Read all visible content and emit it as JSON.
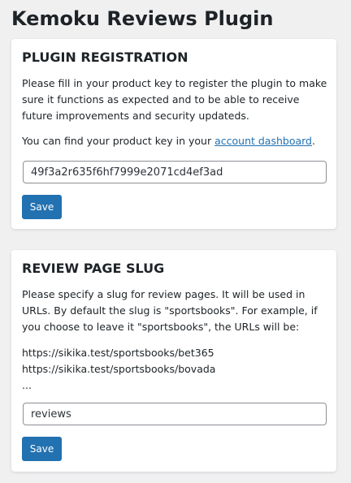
{
  "page": {
    "title": "Kemoku Reviews Plugin"
  },
  "registration": {
    "heading": "PLUGIN REGISTRATION",
    "description": "Please fill in your product key to register the plugin to make sure it functions as expected and to be able to receive future improvements and security updateds.",
    "key_hint_prefix": "You can find your product key in your ",
    "key_hint_link": "account dashboard",
    "key_hint_suffix": ".",
    "product_key_value": "49f3a2r635f6hf7999e2071cd4ef3ad",
    "save_label": "Save"
  },
  "slug": {
    "heading": "REVIEW PAGE SLUG",
    "description": "Please specify a slug for review pages. It will be used in URLs. By default the slug is \"sportsbooks\". For example, if you choose to leave it \"sportsbooks\", the URLs will be:",
    "example_urls": [
      "https://sikika.test/sportsbooks/bet365",
      "https://sikika.test/sportsbooks/bovada",
      "..."
    ],
    "slug_value": "reviews",
    "save_label": "Save"
  },
  "colors": {
    "background": "#f0f0f1",
    "primary_button": "#2271b1",
    "link": "#2271b1",
    "text": "#1d2327"
  }
}
